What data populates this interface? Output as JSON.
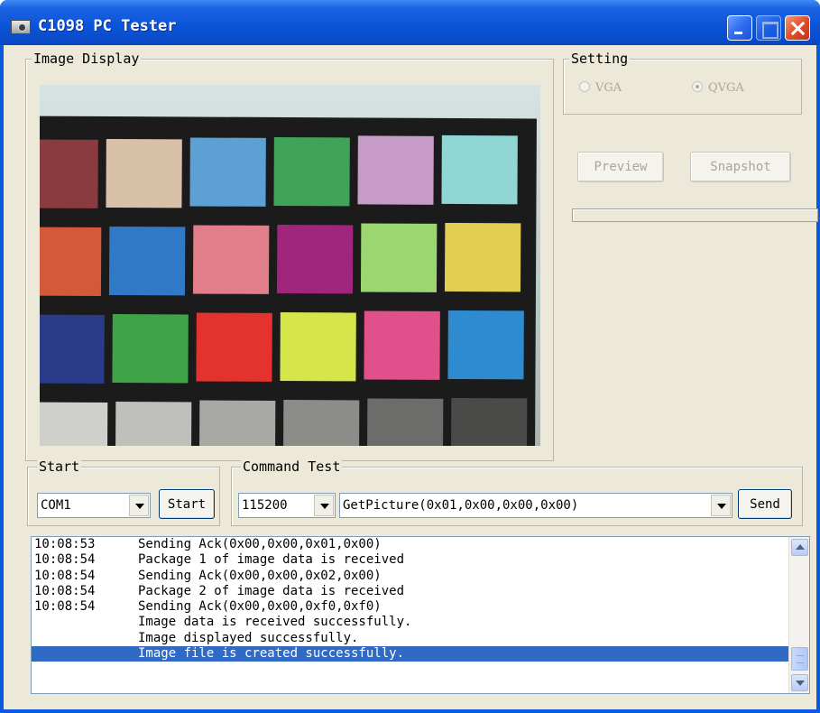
{
  "window": {
    "title": "C1098 PC Tester",
    "colors": {
      "titlebar": "#0a55d8",
      "client": "#ece9d8",
      "selection": "#316ac5"
    }
  },
  "image_display": {
    "label": "Image Display",
    "patch_colors": [
      [
        "#8a3b40",
        "#d9c0a8",
        "#5ca0d4",
        "#3fa35a",
        "#c69bc8",
        "#8fd6d4"
      ],
      [
        "#d4593a",
        "#2f79c6",
        "#e07f8a",
        "#a0257c",
        "#9cd670",
        "#e2ce52"
      ],
      [
        "#2a3b8a",
        "#3fa347",
        "#e4332e",
        "#d6e64a",
        "#e0508a",
        "#2e8bd0"
      ],
      [
        "#cfd0cc",
        "#bfc0bc",
        "#a8a9a5",
        "#8c8d89",
        "#6c6d6a",
        "#4a4b49"
      ]
    ]
  },
  "setting": {
    "label": "Setting",
    "radios": [
      {
        "label": "VGA",
        "checked": false,
        "enabled": false
      },
      {
        "label": "QVGA",
        "checked": true,
        "enabled": false
      }
    ],
    "preview_label": "Preview",
    "snapshot_label": "Snapshot",
    "progress": 0
  },
  "start": {
    "label": "Start",
    "port_value": "COM1",
    "start_button": "Start"
  },
  "command_test": {
    "label": "Command Test",
    "baud_value": "115200",
    "command_value": "GetPicture(0x01,0x00,0x00,0x00)",
    "send_button": "Send"
  },
  "log": [
    {
      "time": "10:08:53",
      "msg": "Sending Ack(0x00,0x00,0x01,0x00)"
    },
    {
      "time": "10:08:54",
      "msg": "Package 1 of image data is received"
    },
    {
      "time": "10:08:54",
      "msg": "Sending Ack(0x00,0x00,0x02,0x00)"
    },
    {
      "time": "10:08:54",
      "msg": "Package 2 of image data is received"
    },
    {
      "time": "10:08:54",
      "msg": "Sending Ack(0x00,0x00,0xf0,0xf0)"
    },
    {
      "time": "",
      "msg": "Image data is received successfully."
    },
    {
      "time": "",
      "msg": "Image displayed successfully."
    },
    {
      "time": "",
      "msg": "Image file is created successfully.",
      "selected": true
    }
  ]
}
